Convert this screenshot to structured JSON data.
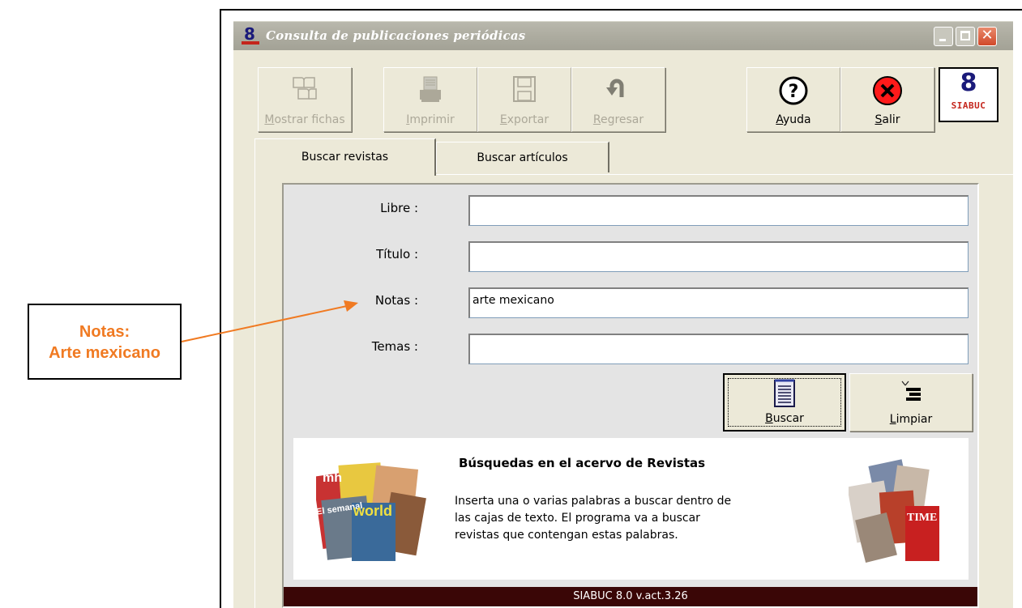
{
  "window": {
    "title": "Consulta de publicaciones periódicas",
    "title_color": "#ffffff",
    "caption_buttons": [
      "minimize",
      "maximize",
      "close"
    ]
  },
  "toolbar": {
    "buttons": [
      {
        "accesskey": "M",
        "rest": "ostrar fichas",
        "enabled": false,
        "icon": "open-book-icon"
      },
      {
        "accesskey": "I",
        "rest": "mprimir",
        "enabled": false,
        "icon": "printer-icon"
      },
      {
        "accesskey": "E",
        "rest": "xportar",
        "enabled": false,
        "icon": "floppy-disk-icon"
      },
      {
        "accesskey": "R",
        "rest": "egresar",
        "enabled": false,
        "icon": "undo-arrow-icon"
      },
      {
        "accesskey": "A",
        "rest": "yuda",
        "enabled": true,
        "icon": "question-mark-icon"
      },
      {
        "accesskey": "S",
        "rest": "alir",
        "enabled": true,
        "icon": "red-x-icon"
      }
    ],
    "logo": {
      "digit": "8",
      "word": "SIABUC"
    }
  },
  "tabs": [
    {
      "label": "Buscar revistas",
      "active": true
    },
    {
      "label": "Buscar artículos",
      "active": false
    }
  ],
  "form": {
    "fields": [
      {
        "label": "Libre :",
        "value": ""
      },
      {
        "label": "Título :",
        "value": ""
      },
      {
        "label": "Notas :",
        "value": "arte mexicano"
      },
      {
        "label": "Temas :",
        "value": ""
      }
    ],
    "buscar": {
      "accesskey": "B",
      "rest": "uscar",
      "icon": "list-document-icon"
    },
    "limpiar": {
      "accesskey": "L",
      "rest": "impiar",
      "icon": "clear-lines-icon"
    }
  },
  "info": {
    "title": "Búsquedas en el acervo de Revistas",
    "lines": [
      "Inserta una o varias palabras a buscar dentro de",
      "las cajas de texto. El programa va a buscar",
      "revistas que contengan estas palabras."
    ],
    "left_image_text": [
      "mh",
      "El semanal",
      "world"
    ],
    "right_image_text": [
      "TIME"
    ]
  },
  "statusbar": {
    "text": "SIABUC 8.0 v.act.3.26",
    "color": "#3a0606"
  },
  "annotation": {
    "line1": "Notas:",
    "line2": "Arte mexicano",
    "color": "#f07a22"
  }
}
